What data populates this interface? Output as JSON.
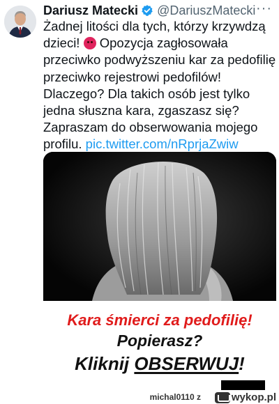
{
  "tweet": {
    "author_name": "Dariusz Matecki",
    "author_handle": "@DariuszMatecki",
    "more_label": "···",
    "text_lines": [
      "Żadnej litości dla tych, którzy krzywdzą",
      "Opozycja zagłosowała",
      "przeciwko podwyższeniu kar za pedofilię i",
      "przeciwko rejestrowi pedofilów!",
      "Dlaczego? Dla takich osób jest tylko",
      "jedna słuszna kara, zgaszasz się?",
      "Zapraszam do obserwowania mojego",
      "profilu."
    ],
    "line2_prefix": "dzieci!",
    "link_text": "pic.twitter.com/nRprjaZwiw"
  },
  "media": {
    "banner_line1": "Kara śmierci za pedofilię!",
    "banner_line2": "Popierasz?",
    "banner_line3_prefix": "Kliknij ",
    "banner_line3_underlined": "OBSERWUJ",
    "banner_line3_suffix": "!"
  },
  "footer": {
    "user": "michal0110  z",
    "site": "wykop.pl"
  },
  "icons": {
    "verified": "verified-badge-icon",
    "emoji": "angry-face-emoji-icon"
  },
  "colors": {
    "link": "#1d9bf0",
    "verified": "#1d9bf0",
    "banner_red": "#e01b1b"
  }
}
